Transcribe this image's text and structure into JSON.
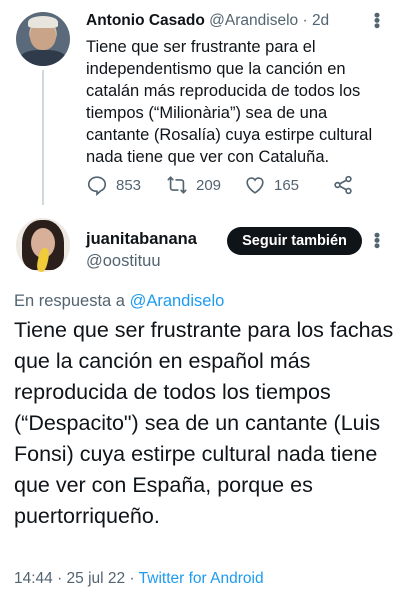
{
  "tweet1": {
    "name": "Antonio Casado",
    "handle": "@Arandiselo",
    "dot": "·",
    "time": "2d",
    "text": "Tiene que ser frustrante para el independentismo que la canción en catalán más reproducida de todos los tiempos (“Milionària”) sea de una cantante (Rosalía) cuya estirpe cultural nada tiene que ver con Cataluña.",
    "replies": "853",
    "retweets": "209",
    "likes": "165",
    "icons": [
      "reply-icon",
      "retweet-icon",
      "like-icon",
      "share-icon",
      "more-icon"
    ]
  },
  "tweet2": {
    "name": "juanitabanana",
    "handle": "@oostituu",
    "follow_label": "Seguir también",
    "replying_prefix": "En respuesta a ",
    "replying_to": "@Arandiselo",
    "text": "Tiene que ser frustrante para los fachas que la canción en español más reproducida de todos los tiempos (“Despacito\") sea de un cantante (Luis Fonsi) cuya estirpe cultural nada tiene que ver con España, porque es puertorriqueño.",
    "timestamp": "14:44 · 25 jul 22 · ",
    "source": "Twitter for Android"
  },
  "colors": {
    "accent": "#1d9bf0",
    "text": "#0f1419",
    "secondary": "#536471",
    "button": "#0f1419"
  }
}
